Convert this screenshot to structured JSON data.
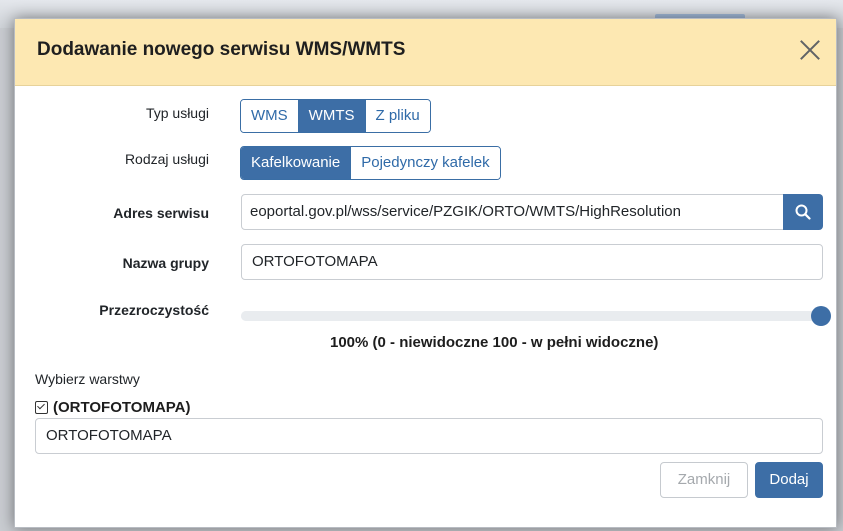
{
  "dialog": {
    "title": "Dodawanie nowego serwisu WMS/WMTS"
  },
  "service_type": {
    "label": "Typ usługi",
    "options": [
      "WMS",
      "WMTS",
      "Z pliku"
    ],
    "selected": "WMTS"
  },
  "service_kind": {
    "label": "Rodzaj usługi",
    "options": [
      "Kafelkowanie",
      "Pojedynczy kafelek"
    ],
    "selected": "Kafelkowanie"
  },
  "service_address": {
    "label": "Adres serwisu",
    "value": "eoportal.gov.pl/wss/service/PZGIK/ORTO/WMTS/HighResolution"
  },
  "group_name": {
    "label": "Nazwa grupy",
    "value": "ORTOFOTOMAPA"
  },
  "transparency": {
    "label": "Przezroczystość",
    "value_percent": 100,
    "caption": "100% (0 - niewidoczne 100 - w pełni widoczne)"
  },
  "layers": {
    "label": "Wybierz warstwy",
    "group_checkbox_label": "(ORTOFOTOMAPA)",
    "group_checked": true,
    "layer_value": "ORTOFOTOMAPA"
  },
  "footer": {
    "close_label": "Zamknij",
    "add_label": "Dodaj"
  },
  "colors": {
    "header_bg": "#fde8b2",
    "accent": "#3d6ea6"
  }
}
